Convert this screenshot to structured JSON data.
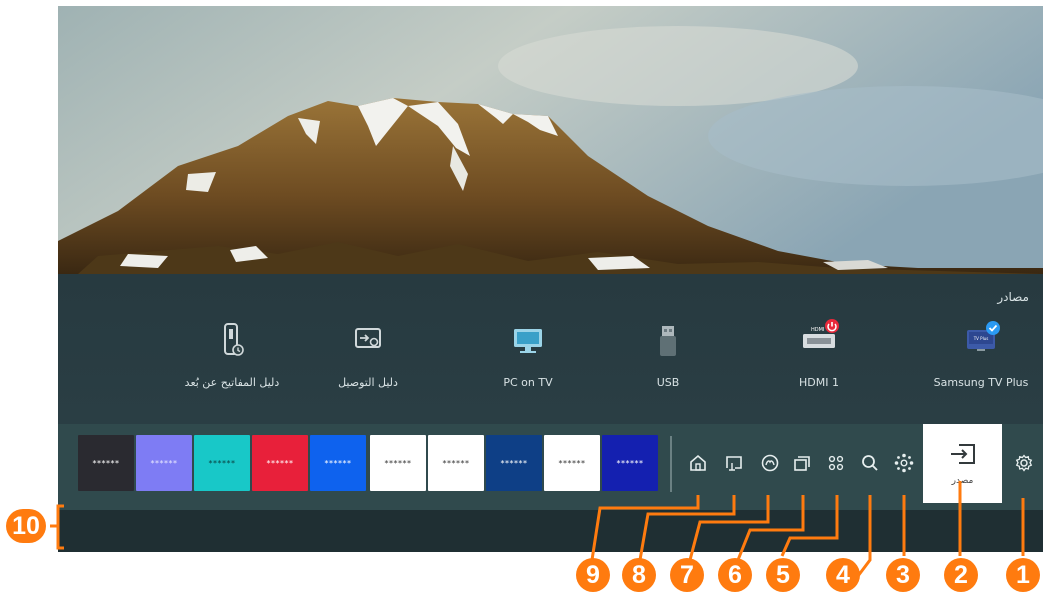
{
  "sources": {
    "title": "مصادر",
    "items": [
      {
        "label": "Samsung TV Plus",
        "icon": "samsung-tv-plus-icon",
        "badge": "check"
      },
      {
        "label": "HDMI 1",
        "icon": "hdmi-icon",
        "badge": "power"
      },
      {
        "label": "USB",
        "icon": "usb-icon"
      },
      {
        "label": "PC on TV",
        "icon": "pc-monitor-icon"
      },
      {
        "label": "دليل التوصيل",
        "icon": "connection-guide-icon"
      },
      {
        "label": "دليل المفاتيح عن بُعد",
        "icon": "remote-guide-icon"
      }
    ]
  },
  "app_bar": {
    "apps": [
      {
        "label": "******",
        "bg": "#2a2a30",
        "fg": "#ffffff"
      },
      {
        "label": "******",
        "bg": "#7e7cf4",
        "fg": "#e8e8ff"
      },
      {
        "label": "******",
        "bg": "#18c8c8",
        "fg": "#0a4040"
      },
      {
        "label": "******",
        "bg": "#e8203a",
        "fg": "#ffffff"
      },
      {
        "label": "******",
        "bg": "#0e62ee",
        "fg": "#ffffff"
      },
      {
        "label": "******",
        "bg": "#ffffff",
        "fg": "#333333"
      },
      {
        "label": "******",
        "bg": "#ffffff",
        "fg": "#333333"
      },
      {
        "label": "******",
        "bg": "#0e3f86",
        "fg": "#ffffff"
      },
      {
        "label": "******",
        "bg": "#ffffff",
        "fg": "#333333"
      },
      {
        "label": "******",
        "bg": "#1420b0",
        "fg": "#ffffff"
      }
    ],
    "nav_icons": [
      "home-icon",
      "ambient-mode-icon",
      "game-icon",
      "multi-view-icon",
      "apps-icon",
      "search-icon",
      "smartthings-icon"
    ],
    "source_button_label": "مصدر",
    "settings_icon": "gear-icon"
  },
  "callouts": [
    "1",
    "2",
    "3",
    "4",
    "5",
    "6",
    "7",
    "8",
    "9",
    "10"
  ],
  "colors": {
    "accent": "#ff7b0f",
    "panel": "#273a40",
    "app_bar": "#304a4d",
    "badge_blue": "#2b9af3",
    "badge_red": "#e8283a"
  }
}
